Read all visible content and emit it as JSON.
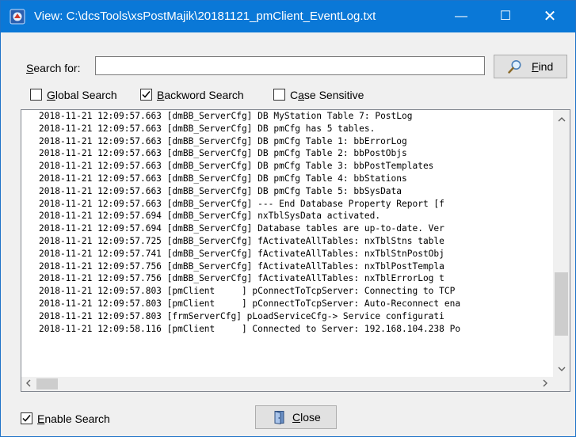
{
  "window": {
    "title": "View: C:\\dcsTools\\xsPostMajik\\20181121_pmClient_EventLog.txt",
    "minimize_glyph": "—",
    "maximize_glyph": "☐",
    "close_glyph": "✕"
  },
  "search": {
    "label_hotkey": "S",
    "label_rest": "earch for:",
    "value": "",
    "find_hotkey": "F",
    "find_rest": "ind"
  },
  "options": {
    "global": {
      "hotkey": "G",
      "rest": "lobal Search",
      "checked": false
    },
    "backward": {
      "hotkey": "B",
      "rest": "ackword Search",
      "checked": true
    },
    "case": {
      "pre": "C",
      "hotkey": "a",
      "rest": "se Sensitive",
      "checked": false
    }
  },
  "log": {
    "lines": [
      "2018-11-21 12:09:57.663 [dmBB_ServerCfg] DB MyStation Table 7: PostLog",
      "2018-11-21 12:09:57.663 [dmBB_ServerCfg] DB pmCfg has 5 tables.",
      "2018-11-21 12:09:57.663 [dmBB_ServerCfg] DB pmCfg Table 1: bbErrorLog",
      "2018-11-21 12:09:57.663 [dmBB_ServerCfg] DB pmCfg Table 2: bbPostObjs",
      "2018-11-21 12:09:57.663 [dmBB_ServerCfg] DB pmCfg Table 3: bbPostTemplates",
      "2018-11-21 12:09:57.663 [dmBB_ServerCfg] DB pmCfg Table 4: bbStations",
      "2018-11-21 12:09:57.663 [dmBB_ServerCfg] DB pmCfg Table 5: bbSysData",
      "2018-11-21 12:09:57.663 [dmBB_ServerCfg] --- End Database Property Report [f",
      "2018-11-21 12:09:57.694 [dmBB_ServerCfg] nxTblSysData activated.",
      "2018-11-21 12:09:57.694 [dmBB_ServerCfg] Database tables are up-to-date. Ver",
      "2018-11-21 12:09:57.725 [dmBB_ServerCfg] fActivateAllTables: nxTblStns table",
      "2018-11-21 12:09:57.741 [dmBB_ServerCfg] fActivateAllTables: nxTblStnPostObj",
      "2018-11-21 12:09:57.756 [dmBB_ServerCfg] fActivateAllTables: nxTblPostTempla",
      "2018-11-21 12:09:57.756 [dmBB_ServerCfg] fActivateAllTables: nxTblErrorLog t",
      "2018-11-21 12:09:57.803 [pmClient     ] pConnectToTcpServer: Connecting to TCP",
      "2018-11-21 12:09:57.803 [pmClient     ] pConnectToTcpServer: Auto-Reconnect ena",
      "2018-11-21 12:09:57.803 [frmServerCfg] pLoadServiceCfg-> Service configurati",
      "2018-11-21 12:09:58.116 [pmClient     ] Connected to Server: 192.168.104.238 Po"
    ],
    "vscroll_position": 0.86,
    "hscroll_position": 0.0
  },
  "footer": {
    "enable": {
      "hotkey": "E",
      "rest": "nable Search",
      "checked": true
    },
    "close_hotkey": "C",
    "close_rest": "lose"
  },
  "colors": {
    "titlebar": "#0a78d7",
    "window_bg": "#f0f0f0",
    "button_bg": "#e1e1e1"
  },
  "icons": {
    "app": "app-icon",
    "find": "magnifier-icon",
    "close": "door-exit-icon",
    "check": "checkmark-icon"
  }
}
